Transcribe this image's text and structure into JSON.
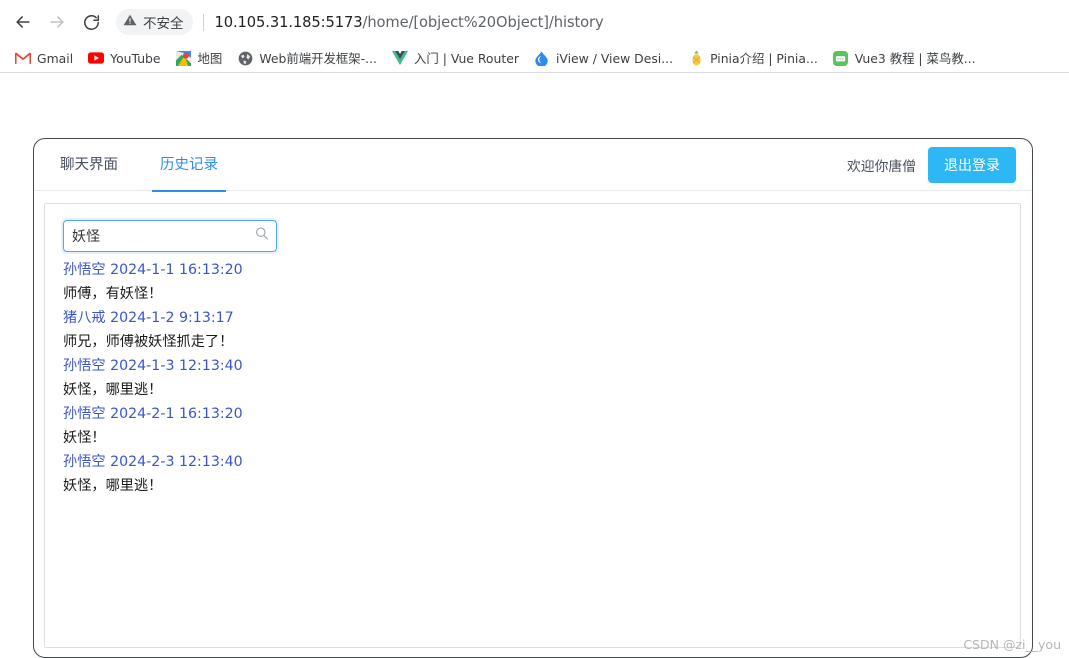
{
  "browser": {
    "nav": {
      "back_icon": "arrow-left-icon",
      "forward_icon": "arrow-right-icon",
      "reload_icon": "reload-icon"
    },
    "omnibox": {
      "security_icon": "warning-triangle-icon",
      "security_label": "不安全",
      "url_host": "10.105.31.185:5173",
      "url_path": "/home/[object%20Object]/history"
    },
    "bookmarks": [
      {
        "label": "Gmail",
        "icon": "gmail-icon"
      },
      {
        "label": "YouTube",
        "icon": "youtube-icon"
      },
      {
        "label": "地图",
        "icon": "google-maps-icon"
      },
      {
        "label": "Web前端开发框架-...",
        "icon": "globe-icon"
      },
      {
        "label": "入门 | Vue Router",
        "icon": "vue-icon"
      },
      {
        "label": "iView / View Desi...",
        "icon": "iview-icon"
      },
      {
        "label": "Pinia介绍 | Pinia...",
        "icon": "pineapple-icon"
      },
      {
        "label": "Vue3 教程 | 菜鸟教...",
        "icon": "runoob-icon"
      }
    ]
  },
  "app": {
    "tabs": [
      {
        "label": "聊天界面",
        "active": false
      },
      {
        "label": "历史记录",
        "active": true
      }
    ],
    "welcome": "欢迎你唐僧",
    "logout_label": "退出登录",
    "search": {
      "value": "妖怪",
      "placeholder": "",
      "icon": "search-icon"
    },
    "messages": [
      {
        "sender": "孙悟空",
        "time": "2024-1-1 16:13:20",
        "text": "师傅，有妖怪！"
      },
      {
        "sender": "猪八戒",
        "time": "2024-1-2 9:13:17",
        "text": "师兄，师傅被妖怪抓走了！"
      },
      {
        "sender": "孙悟空",
        "time": "2024-1-3 12:13:40",
        "text": "妖怪，哪里逃！"
      },
      {
        "sender": "孙悟空",
        "time": "2024-2-1 16:13:20",
        "text": "妖怪！"
      },
      {
        "sender": "孙悟空",
        "time": "2024-2-3 12:13:40",
        "text": "妖怪，哪里逃！"
      }
    ]
  },
  "watermark": "CSDN @zi__you",
  "colors": {
    "accent_blue": "#2d8cf0",
    "button_blue": "#2db7f5",
    "link_blue": "#3c55c8"
  }
}
